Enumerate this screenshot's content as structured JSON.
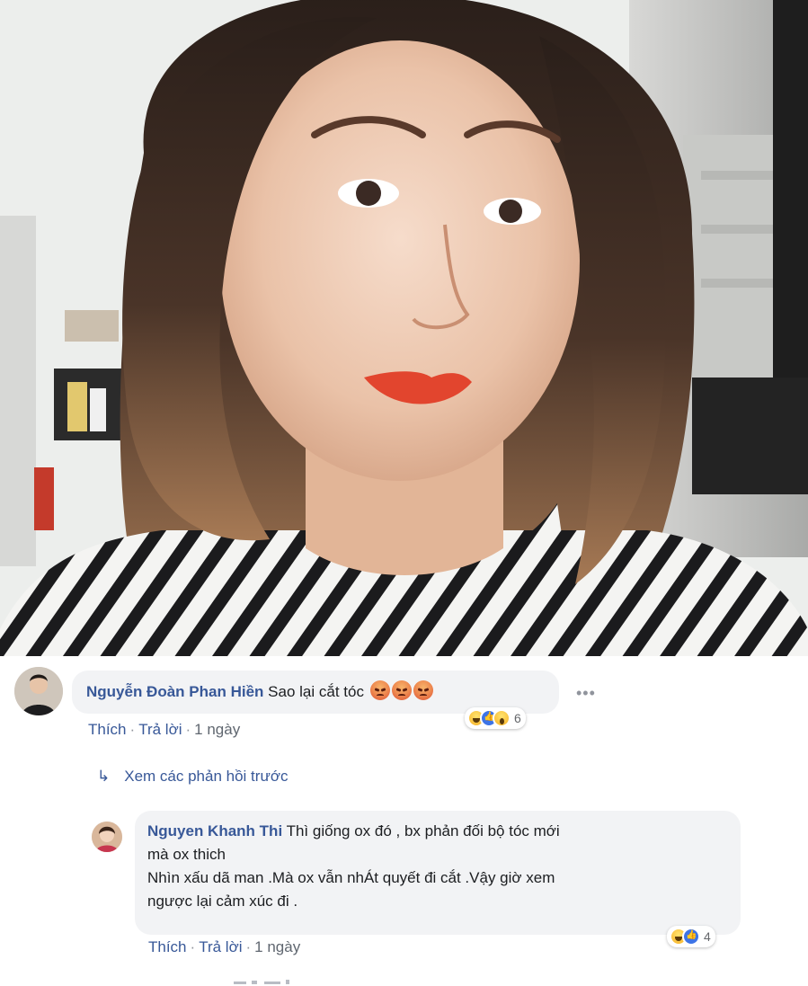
{
  "photo": {
    "description_icon": "selfie-photo"
  },
  "comment1": {
    "author": "Nguyễn Đoàn Phan Hiền",
    "text": "Sao lại cắt tóc",
    "emojis": [
      "angry",
      "angry",
      "angry"
    ],
    "reaction_icons": [
      "haha-icon",
      "like-icon",
      "wow-icon"
    ],
    "reaction_count": "6",
    "more_label": "•••",
    "actions": {
      "like": "Thích",
      "reply": "Trả lời",
      "time": "1 ngày"
    }
  },
  "view_previous": {
    "label": "Xem các phản hồi trước",
    "icon": "reply-arrow-icon"
  },
  "comment2": {
    "author": "Nguyen Khanh Thi",
    "text_line1": "Thì giống ox đó , bx phản đối bộ tóc mới",
    "text_line2": "mà ox thich",
    "text_line3": "Nhìn xấu dã man .Mà ox vẫn nhÁt quyết đi cắt .Vậy giờ xem",
    "text_line4": "ngược lại cảm xúc đi .",
    "reaction_icons": [
      "haha-icon",
      "like-icon"
    ],
    "reaction_count": "4",
    "actions": {
      "like": "Thích",
      "reply": "Trả lời",
      "time": "1 ngày"
    }
  },
  "colors": {
    "link": "#385898",
    "bubble": "#f2f3f5",
    "meta": "#606770"
  }
}
